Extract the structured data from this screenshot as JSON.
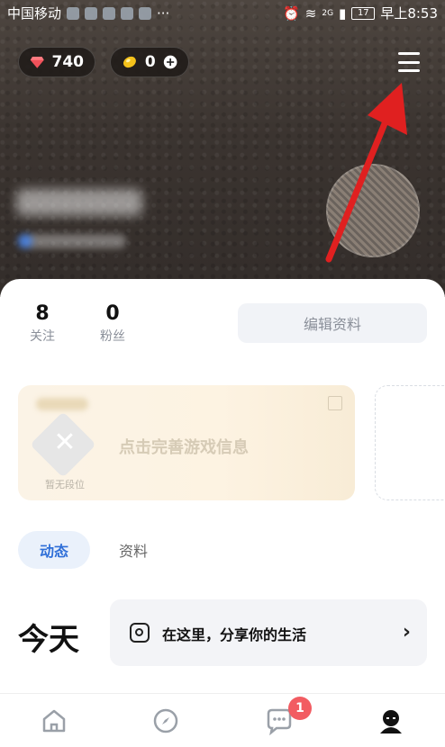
{
  "status_bar": {
    "carrier": "中国移动",
    "time": "早上8:53",
    "battery": "17",
    "network": "2G"
  },
  "currency": {
    "gems": "740",
    "coins": "0"
  },
  "profile": {
    "following_count": "8",
    "following_label": "关注",
    "followers_count": "0",
    "followers_label": "粉丝",
    "edit_button": "编辑资料"
  },
  "game_card": {
    "rank_label": "暂无段位",
    "prompt": "点击完善游戏信息"
  },
  "tabs": {
    "active": "动态",
    "other": "资料"
  },
  "feed": {
    "today": "今天",
    "share_prompt": "在这里，分享你的生活"
  },
  "bottom_nav": {
    "messages_badge": "1"
  },
  "colors": {
    "accent_blue": "#2f6fd8",
    "badge_red": "#f25c62",
    "arrow_red": "#e02020"
  }
}
